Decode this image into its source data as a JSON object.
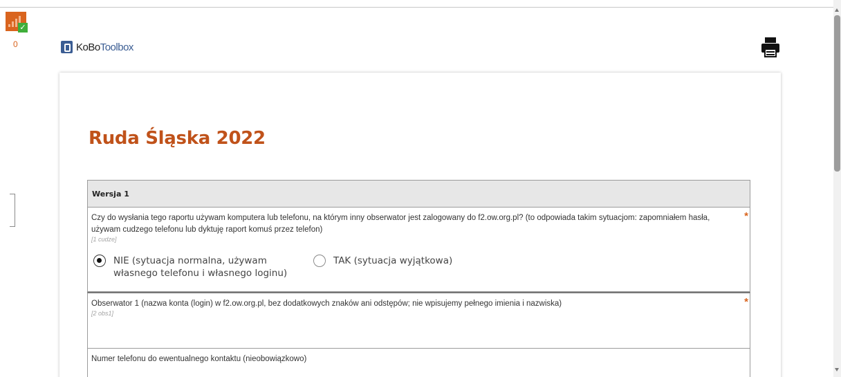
{
  "status": {
    "count": "0"
  },
  "logo": {
    "part1": "KoBo",
    "part2": "Toolbox"
  },
  "form": {
    "title": "Ruda Śląska 2022",
    "group_label": "Wersja 1",
    "questions": [
      {
        "label": "Czy do wysłania tego raportu używam komputera lub telefonu, na którym inny obserwator jest zalogowany do f2.ow.org.pl? (to odpowiada takim sytuacjom: zapomniałem hasła, używam cudzego telefonu lub dyktuję raport komuś przez telefon)",
        "hint": "[1 cudze]",
        "required": "*",
        "options": [
          {
            "label": "NIE (sytuacja normalna, używam własnego telefonu i własnego loginu)",
            "checked": true
          },
          {
            "label": "TAK (sytuacja wyjątkowa)",
            "checked": false
          }
        ]
      },
      {
        "label": "Obserwator 1 (nazwa konta (login) w f2.ow.org.pl, bez dodatkowych znaków ani odstępów; nie wpisujemy pełnego imienia i nazwiska)",
        "hint": "[2 obs1]",
        "required": "*"
      },
      {
        "label": "Numer telefonu do ewentualnego kontaktu (nieobowiązkowo)"
      }
    ]
  },
  "colors": {
    "accent": "#d9641e",
    "title": "#c0521a",
    "logo_blue": "#3b5d93",
    "status_ok": "#3fae3a"
  },
  "icons": {
    "print": "printer-icon",
    "status": "signal-bars-icon",
    "check": "check-icon"
  }
}
